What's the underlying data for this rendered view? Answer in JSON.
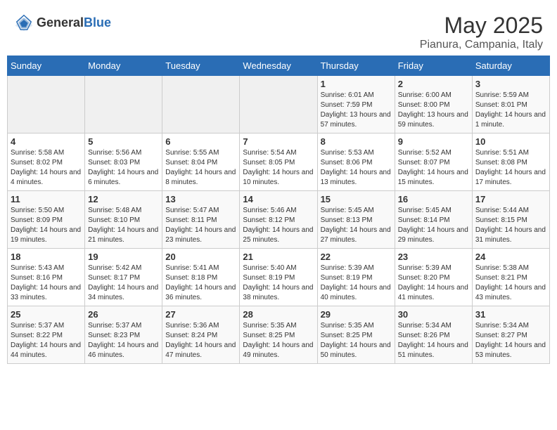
{
  "logo": {
    "general": "General",
    "blue": "Blue"
  },
  "title": "May 2025",
  "subtitle": "Pianura, Campania, Italy",
  "headers": [
    "Sunday",
    "Monday",
    "Tuesday",
    "Wednesday",
    "Thursday",
    "Friday",
    "Saturday"
  ],
  "weeks": [
    [
      {
        "day": "",
        "info": ""
      },
      {
        "day": "",
        "info": ""
      },
      {
        "day": "",
        "info": ""
      },
      {
        "day": "",
        "info": ""
      },
      {
        "day": "1",
        "info": "Sunrise: 6:01 AM\nSunset: 7:59 PM\nDaylight: 13 hours and 57 minutes."
      },
      {
        "day": "2",
        "info": "Sunrise: 6:00 AM\nSunset: 8:00 PM\nDaylight: 13 hours and 59 minutes."
      },
      {
        "day": "3",
        "info": "Sunrise: 5:59 AM\nSunset: 8:01 PM\nDaylight: 14 hours and 1 minute."
      }
    ],
    [
      {
        "day": "4",
        "info": "Sunrise: 5:58 AM\nSunset: 8:02 PM\nDaylight: 14 hours and 4 minutes."
      },
      {
        "day": "5",
        "info": "Sunrise: 5:56 AM\nSunset: 8:03 PM\nDaylight: 14 hours and 6 minutes."
      },
      {
        "day": "6",
        "info": "Sunrise: 5:55 AM\nSunset: 8:04 PM\nDaylight: 14 hours and 8 minutes."
      },
      {
        "day": "7",
        "info": "Sunrise: 5:54 AM\nSunset: 8:05 PM\nDaylight: 14 hours and 10 minutes."
      },
      {
        "day": "8",
        "info": "Sunrise: 5:53 AM\nSunset: 8:06 PM\nDaylight: 14 hours and 13 minutes."
      },
      {
        "day": "9",
        "info": "Sunrise: 5:52 AM\nSunset: 8:07 PM\nDaylight: 14 hours and 15 minutes."
      },
      {
        "day": "10",
        "info": "Sunrise: 5:51 AM\nSunset: 8:08 PM\nDaylight: 14 hours and 17 minutes."
      }
    ],
    [
      {
        "day": "11",
        "info": "Sunrise: 5:50 AM\nSunset: 8:09 PM\nDaylight: 14 hours and 19 minutes."
      },
      {
        "day": "12",
        "info": "Sunrise: 5:48 AM\nSunset: 8:10 PM\nDaylight: 14 hours and 21 minutes."
      },
      {
        "day": "13",
        "info": "Sunrise: 5:47 AM\nSunset: 8:11 PM\nDaylight: 14 hours and 23 minutes."
      },
      {
        "day": "14",
        "info": "Sunrise: 5:46 AM\nSunset: 8:12 PM\nDaylight: 14 hours and 25 minutes."
      },
      {
        "day": "15",
        "info": "Sunrise: 5:45 AM\nSunset: 8:13 PM\nDaylight: 14 hours and 27 minutes."
      },
      {
        "day": "16",
        "info": "Sunrise: 5:45 AM\nSunset: 8:14 PM\nDaylight: 14 hours and 29 minutes."
      },
      {
        "day": "17",
        "info": "Sunrise: 5:44 AM\nSunset: 8:15 PM\nDaylight: 14 hours and 31 minutes."
      }
    ],
    [
      {
        "day": "18",
        "info": "Sunrise: 5:43 AM\nSunset: 8:16 PM\nDaylight: 14 hours and 33 minutes."
      },
      {
        "day": "19",
        "info": "Sunrise: 5:42 AM\nSunset: 8:17 PM\nDaylight: 14 hours and 34 minutes."
      },
      {
        "day": "20",
        "info": "Sunrise: 5:41 AM\nSunset: 8:18 PM\nDaylight: 14 hours and 36 minutes."
      },
      {
        "day": "21",
        "info": "Sunrise: 5:40 AM\nSunset: 8:19 PM\nDaylight: 14 hours and 38 minutes."
      },
      {
        "day": "22",
        "info": "Sunrise: 5:39 AM\nSunset: 8:19 PM\nDaylight: 14 hours and 40 minutes."
      },
      {
        "day": "23",
        "info": "Sunrise: 5:39 AM\nSunset: 8:20 PM\nDaylight: 14 hours and 41 minutes."
      },
      {
        "day": "24",
        "info": "Sunrise: 5:38 AM\nSunset: 8:21 PM\nDaylight: 14 hours and 43 minutes."
      }
    ],
    [
      {
        "day": "25",
        "info": "Sunrise: 5:37 AM\nSunset: 8:22 PM\nDaylight: 14 hours and 44 minutes."
      },
      {
        "day": "26",
        "info": "Sunrise: 5:37 AM\nSunset: 8:23 PM\nDaylight: 14 hours and 46 minutes."
      },
      {
        "day": "27",
        "info": "Sunrise: 5:36 AM\nSunset: 8:24 PM\nDaylight: 14 hours and 47 minutes."
      },
      {
        "day": "28",
        "info": "Sunrise: 5:35 AM\nSunset: 8:25 PM\nDaylight: 14 hours and 49 minutes."
      },
      {
        "day": "29",
        "info": "Sunrise: 5:35 AM\nSunset: 8:25 PM\nDaylight: 14 hours and 50 minutes."
      },
      {
        "day": "30",
        "info": "Sunrise: 5:34 AM\nSunset: 8:26 PM\nDaylight: 14 hours and 51 minutes."
      },
      {
        "day": "31",
        "info": "Sunrise: 5:34 AM\nSunset: 8:27 PM\nDaylight: 14 hours and 53 minutes."
      }
    ]
  ]
}
